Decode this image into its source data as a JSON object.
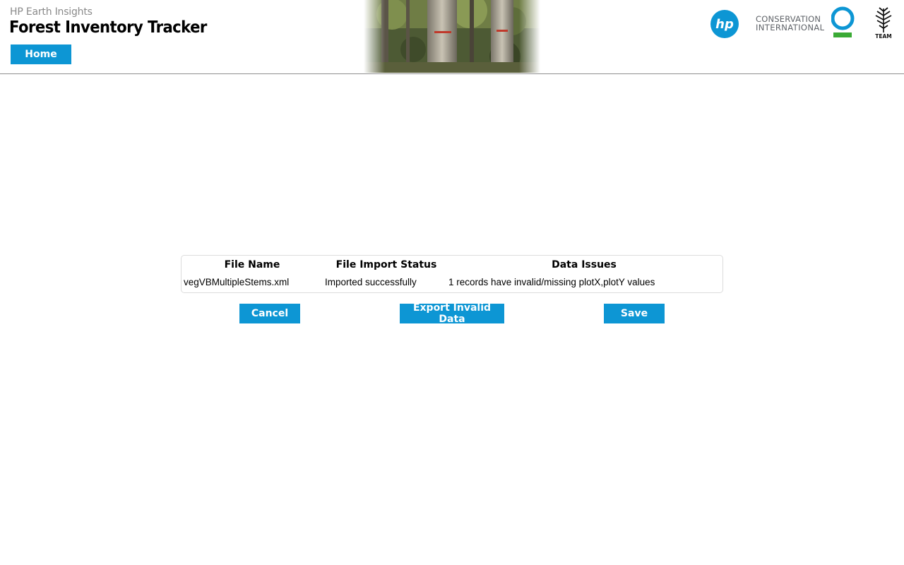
{
  "header": {
    "brand_subtitle": "HP Earth Insights",
    "app_title": "Forest Inventory Tracker",
    "nav": {
      "home_label": "Home"
    },
    "partners": {
      "hp_logo_text": "hp",
      "conservation_line1": "CONSERVATION",
      "conservation_line2": "INTERNATIONAL",
      "team_label": "TEAM"
    }
  },
  "import_results": {
    "columns": {
      "file_name": "File Name",
      "status": "File Import Status",
      "issues": "Data Issues"
    },
    "rows": [
      {
        "file_name": "vegVBMultipleStems.xml",
        "status": "Imported successfully",
        "issues": "1 records have invalid/missing plotX,plotY values"
      }
    ]
  },
  "actions": {
    "cancel_label": "Cancel",
    "export_label": "Export Invalid Data",
    "save_label": "Save"
  },
  "colors": {
    "accent": "#0d96d4",
    "ci_green": "#3aaa35"
  }
}
